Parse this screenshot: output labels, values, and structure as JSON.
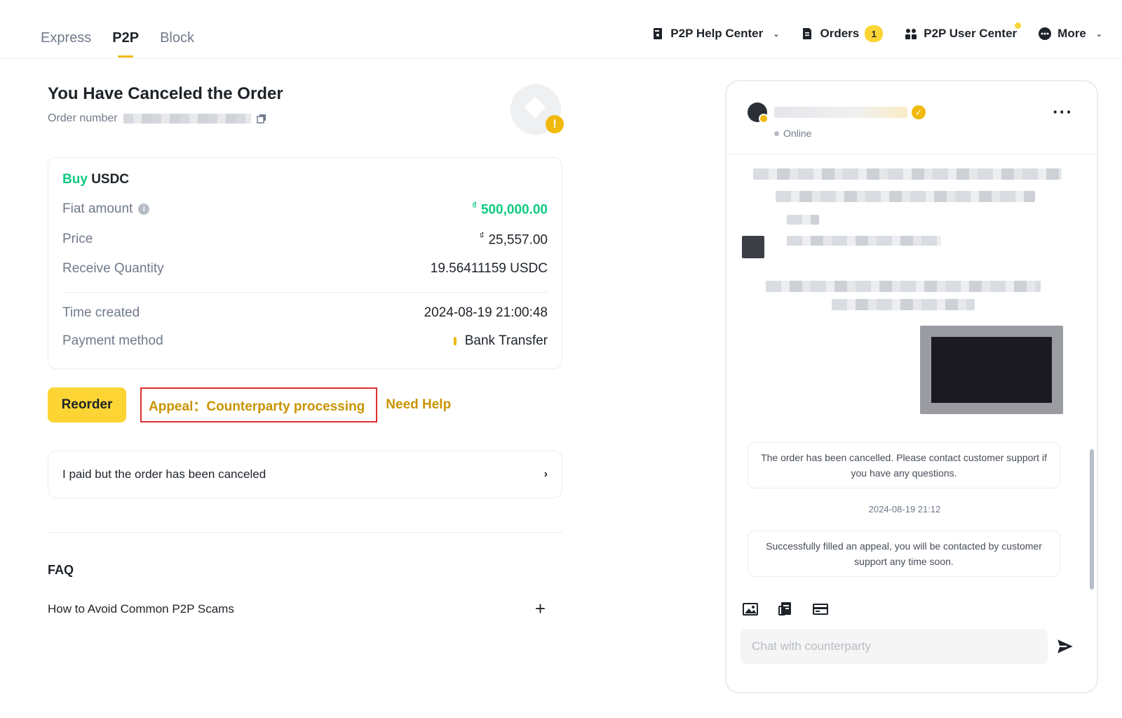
{
  "tabs": [
    {
      "label": "Express"
    },
    {
      "label": "P2P"
    },
    {
      "label": "Block"
    }
  ],
  "topnav": {
    "help_center": "P2P Help Center",
    "orders": "Orders",
    "orders_badge": "1",
    "user_center": "P2P User Center",
    "more": "More"
  },
  "order": {
    "title": "You Have Canceled the Order",
    "order_number_label": "Order number",
    "side": "Buy",
    "asset": "USDC",
    "fiat_amount_label": "Fiat amount",
    "fiat_amount_currency": "₫",
    "fiat_amount_value": "500,000.00",
    "price_label": "Price",
    "price_currency": "₫",
    "price_value": "25,557.00",
    "receive_label": "Receive Quantity",
    "receive_value": "19.56411159 USDC",
    "time_label": "Time created",
    "time_value": "2024-08-19 21:00:48",
    "payment_label": "Payment method",
    "payment_value": "Bank Transfer"
  },
  "actions": {
    "reorder": "Reorder",
    "appeal": "Appeal：Counterparty processing",
    "need_help": "Need Help"
  },
  "paid_canceled": "I paid but the order has been canceled",
  "faq": {
    "title": "FAQ",
    "items": [
      {
        "label": "How to Avoid Common P2P Scams"
      }
    ]
  },
  "chat": {
    "status": "Online",
    "system_msg_1": "The order has been cancelled. Please contact customer support if you have any questions.",
    "timestamp": "2024-08-19 21:12",
    "system_msg_2": "Successfully filled an appeal, you will be contacted by customer support any time soon.",
    "input_placeholder": "Chat with counterparty"
  },
  "colors": {
    "accent": "#fcd535",
    "buy_green": "#0ecb81",
    "link_gold": "#c99400",
    "highlight_red": "#e02e2e"
  }
}
